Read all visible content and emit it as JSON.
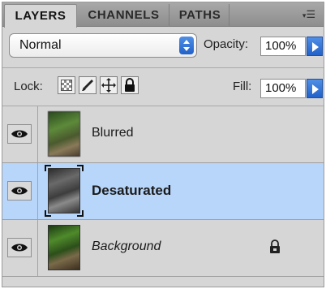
{
  "tabs": [
    {
      "label": "LAYERS",
      "active": true
    },
    {
      "label": "CHANNELS",
      "active": false
    },
    {
      "label": "PATHS",
      "active": false
    }
  ],
  "panel_menu_icon": "panel-menu-icon",
  "blend_mode": {
    "value": "Normal"
  },
  "opacity": {
    "label": "Opacity:",
    "value": "100%"
  },
  "lock": {
    "label": "Lock:",
    "icons": [
      "lock-transparent-pixels-icon",
      "lock-image-pixels-icon",
      "lock-position-icon",
      "lock-all-icon"
    ]
  },
  "fill": {
    "label": "Fill:",
    "value": "100%"
  },
  "layers": [
    {
      "name": "Blurred",
      "visible": true,
      "selected": false,
      "locked": false
    },
    {
      "name": "Desaturated",
      "visible": true,
      "selected": true,
      "locked": false
    },
    {
      "name": "Background",
      "visible": true,
      "selected": false,
      "locked": true
    }
  ],
  "colors": {
    "panel": "#d6d6d6",
    "tabbar": "#9a9a9a",
    "selection": "#b7d6fa",
    "accent": "#2f72d9"
  }
}
